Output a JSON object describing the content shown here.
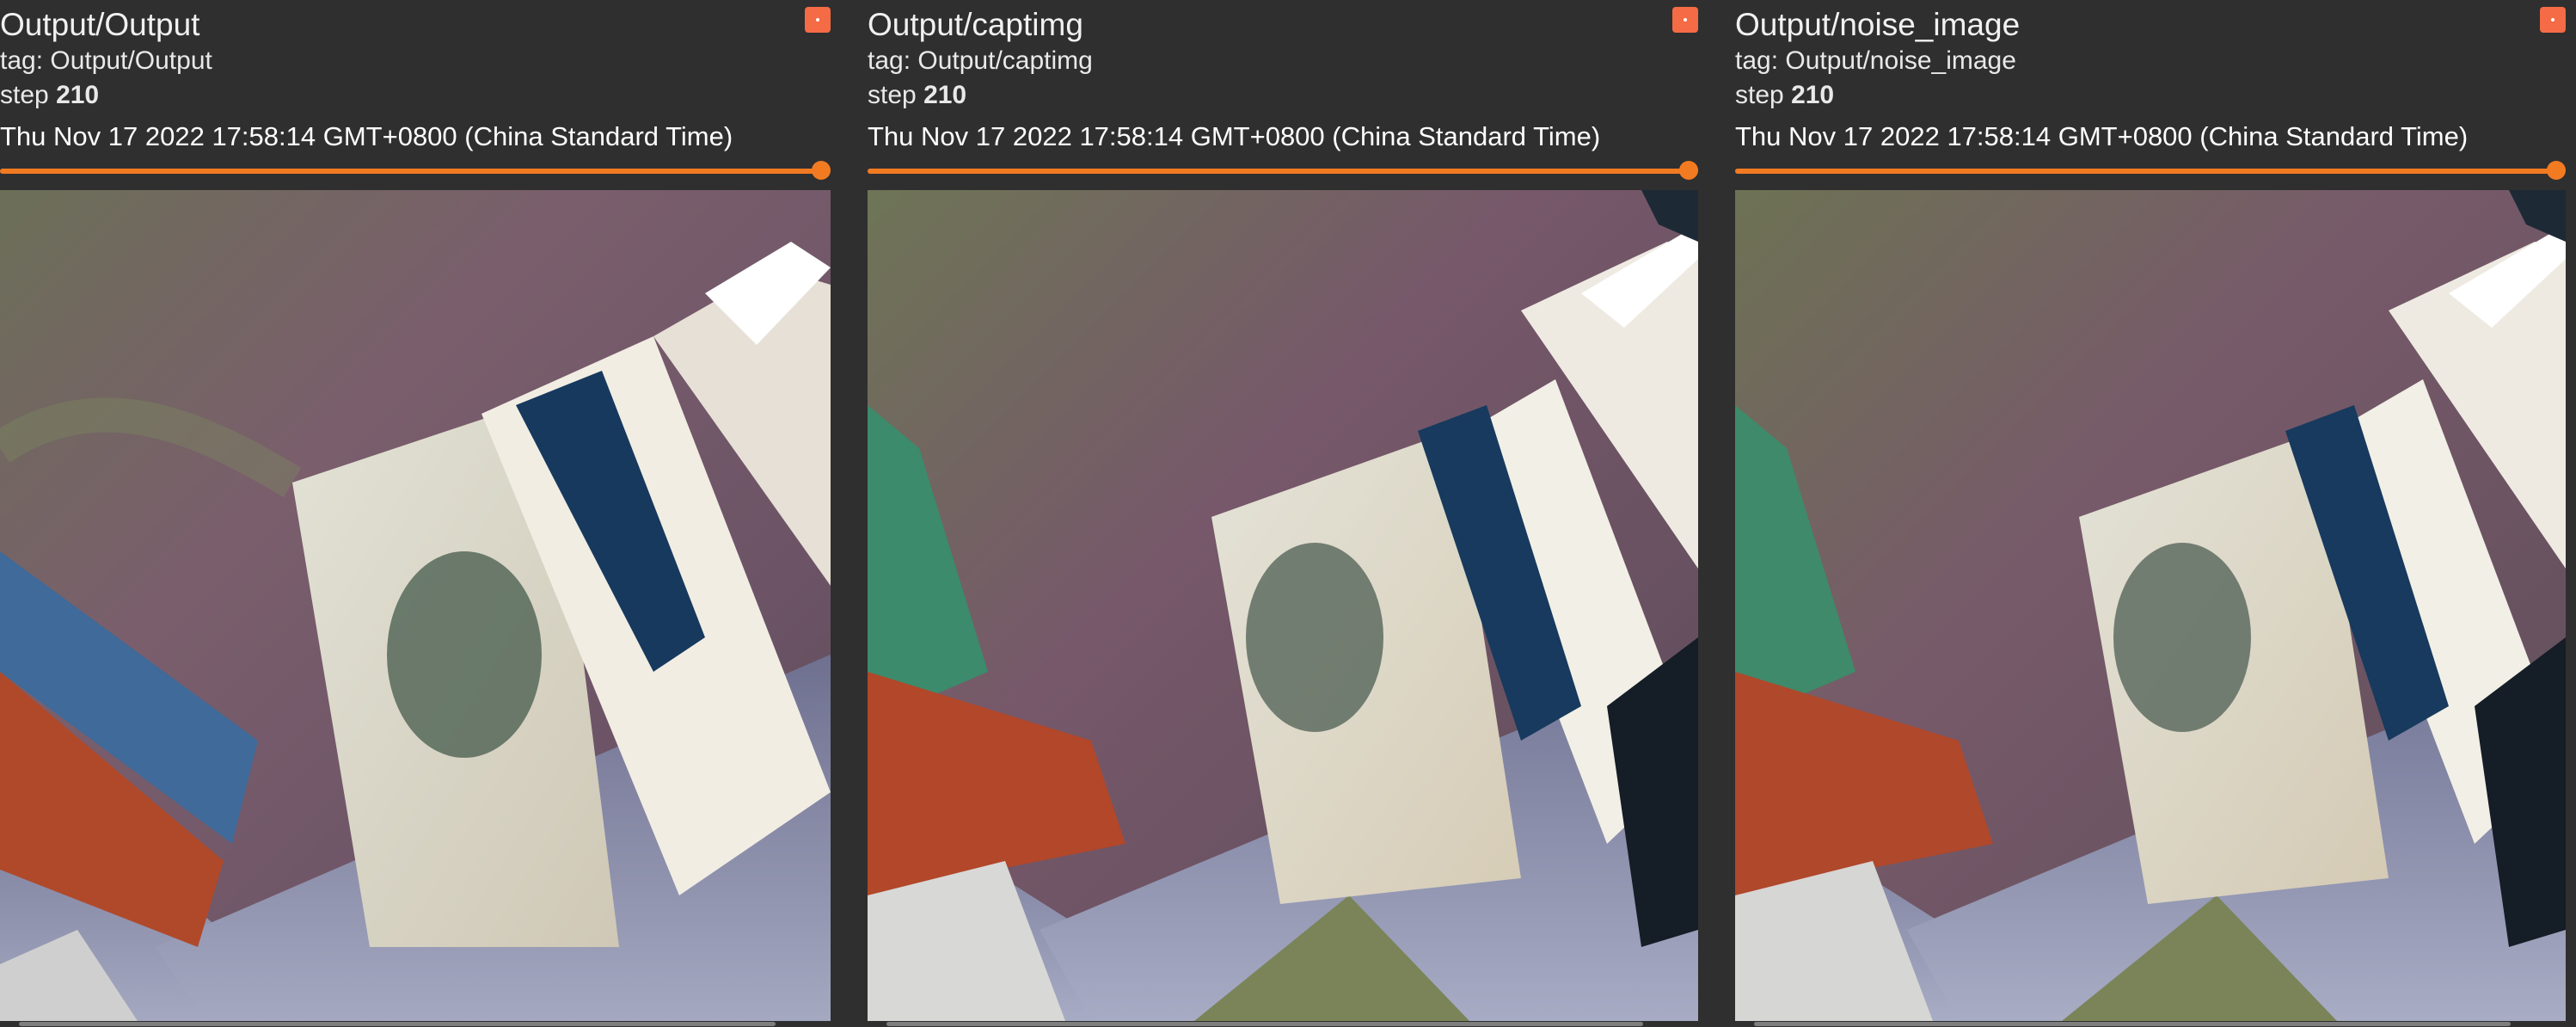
{
  "cards": [
    {
      "title": "Output/Output",
      "tag_label": "tag:",
      "tag": "Output/Output",
      "step_label": "step",
      "step": "210",
      "timestamp": "Thu Nov 17 2022 17:58:14 GMT+0800 (China Standard Time)",
      "step_slider_fraction": 1.0,
      "image_alt": "training output image: tilted white panels with tree painting, blue feathers, grey carpet floor"
    },
    {
      "title": "Output/captimg",
      "tag_label": "tag:",
      "tag": "Output/captimg",
      "step_label": "step",
      "step": "210",
      "timestamp": "Thu Nov 17 2022 17:58:14 GMT+0800 (China Standard Time)",
      "step_slider_fraction": 1.0,
      "image_alt": "captured image: blurred tilted panels with tree painting, grey carpet floor"
    },
    {
      "title": "Output/noise_image",
      "tag_label": "tag:",
      "tag": "Output/noise_image",
      "step_label": "step",
      "step": "210",
      "timestamp": "Thu Nov 17 2022 17:58:14 GMT+0800 (China Standard Time)",
      "step_slider_fraction": 1.0,
      "image_alt": "noise image: blurred tilted panels with tree painting, grey carpet floor"
    }
  ],
  "colors": {
    "background": "#2f2f2f",
    "accent_orange": "#f27b22",
    "expand_button": "#f46b45"
  },
  "icons": {
    "expand": "expand-icon"
  }
}
